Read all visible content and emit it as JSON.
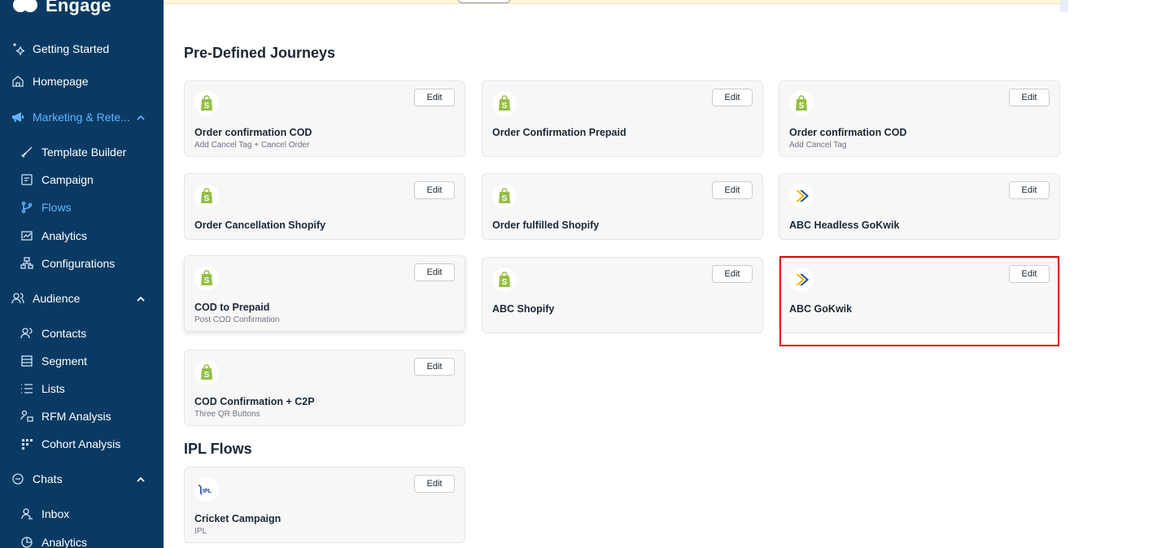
{
  "app": {
    "logo_text": "Engage"
  },
  "sidebar": {
    "items": [
      {
        "label": "Getting Started",
        "icon": "sparkle-icon"
      },
      {
        "label": "Homepage",
        "icon": "home-icon"
      },
      {
        "label": "Marketing & Rete...",
        "icon": "megaphone-icon"
      },
      {
        "label": "Template Builder",
        "icon": "brush-icon"
      },
      {
        "label": "Campaign",
        "icon": "campaign-icon"
      },
      {
        "label": "Flows",
        "icon": "flow-icon"
      },
      {
        "label": "Analytics",
        "icon": "chart-icon"
      },
      {
        "label": "Configurations",
        "icon": "config-icon"
      },
      {
        "label": "Audience",
        "icon": "people-icon"
      },
      {
        "label": "Contacts",
        "icon": "contacts-icon"
      },
      {
        "label": "Segment",
        "icon": "segment-icon"
      },
      {
        "label": "Lists",
        "icon": "list-icon"
      },
      {
        "label": "RFM Analysis",
        "icon": "rfm-icon"
      },
      {
        "label": "Cohort Analysis",
        "icon": "grid-icon"
      },
      {
        "label": "Chats",
        "icon": "chat-icon"
      },
      {
        "label": "Inbox",
        "icon": "inbox-icon"
      },
      {
        "label": "Analytics",
        "icon": "pie-icon"
      }
    ]
  },
  "sections": {
    "predefined_title": "Pre-Defined Journeys",
    "ipl_title": "IPL Flows"
  },
  "edit_label": "Edit",
  "cards": [
    {
      "title": "Order confirmation COD",
      "subtitle": "Add Cancel Tag + Cancel Order",
      "logo": "shopify"
    },
    {
      "title": "Order Confirmation Prepaid",
      "subtitle": "",
      "logo": "shopify"
    },
    {
      "title": "Order confirmation COD",
      "subtitle": "Add Cancel Tag",
      "logo": "shopify"
    },
    {
      "title": "Order Cancellation Shopify",
      "subtitle": "",
      "logo": "shopify"
    },
    {
      "title": "Order fulfilled Shopify",
      "subtitle": "",
      "logo": "shopify"
    },
    {
      "title": "ABC Headless GoKwik",
      "subtitle": "",
      "logo": "gokwik"
    },
    {
      "title": "COD to Prepaid",
      "subtitle": "Post COD Confirmation",
      "logo": "shopify"
    },
    {
      "title": "ABC Shopify",
      "subtitle": "",
      "logo": "shopify"
    },
    {
      "title": "ABC GoKwik",
      "subtitle": "",
      "logo": "gokwik"
    },
    {
      "title": "COD Confirmation + C2P",
      "subtitle": "Three QR Buttons",
      "logo": "shopify"
    },
    {
      "title": "Cricket Campaign",
      "subtitle": "IPL",
      "logo": "ipl",
      "logo_text": "IPL"
    }
  ],
  "colors": {
    "sidebar_bg": "#0a3a63",
    "active_nav": "#63b3ff",
    "shopify_green": "#95bf47",
    "gokwik_blue": "#1c4a9c",
    "gokwik_yellow": "#f4b400",
    "highlight": "#d9000d"
  }
}
